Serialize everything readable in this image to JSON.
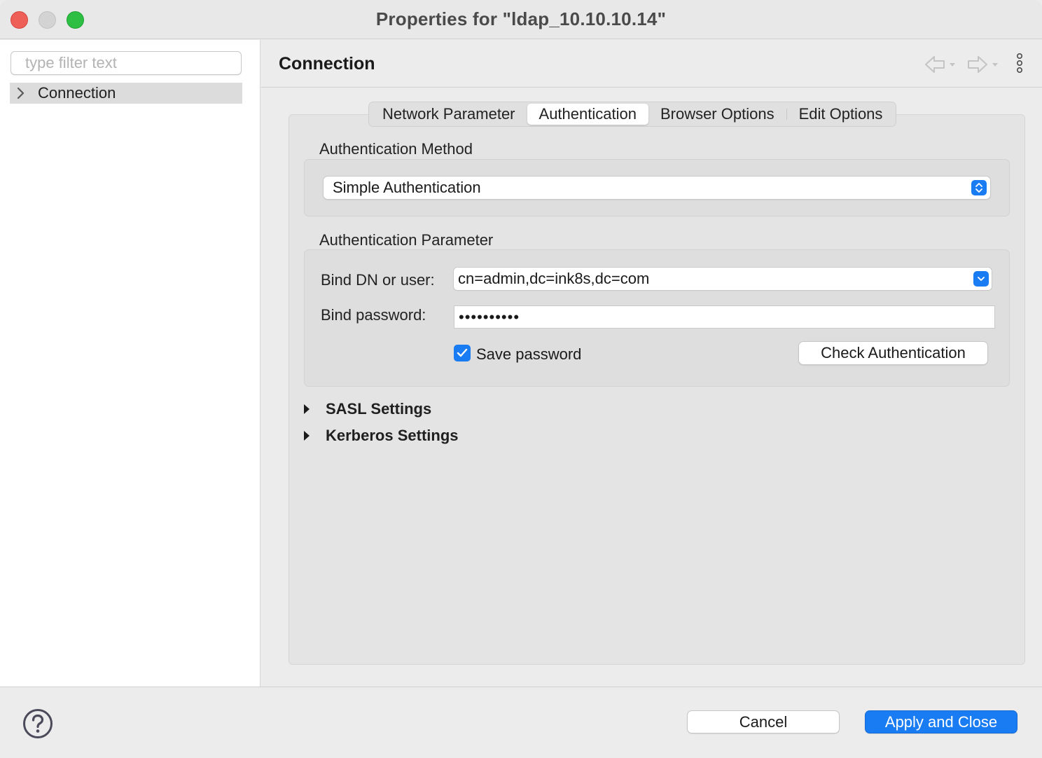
{
  "window": {
    "title": "Properties for \"ldap_10.10.10.14\""
  },
  "sidebar": {
    "filter_placeholder": "type filter text",
    "items": [
      {
        "label": "Connection",
        "expanded": false,
        "selected": true
      }
    ]
  },
  "page": {
    "title": "Connection",
    "tabs": [
      {
        "label": "Network Parameter",
        "active": false
      },
      {
        "label": "Authentication",
        "active": true
      },
      {
        "label": "Browser Options",
        "active": false
      },
      {
        "label": "Edit Options",
        "active": false
      }
    ],
    "auth_method": {
      "section_label": "Authentication Method",
      "selected": "Simple Authentication"
    },
    "auth_param": {
      "section_label": "Authentication Parameter",
      "bind_dn_label": "Bind DN or user:",
      "bind_dn_value": "cn=admin,dc=ink8s,dc=com",
      "bind_password_label": "Bind password:",
      "bind_password_masked": "••••••••••",
      "save_password_label": "Save password",
      "save_password_checked": true,
      "check_auth_label": "Check Authentication"
    },
    "expanders": [
      {
        "label": "SASL Settings"
      },
      {
        "label": "Kerberos Settings"
      }
    ]
  },
  "footer": {
    "cancel_label": "Cancel",
    "apply_label": "Apply and Close"
  },
  "icons": {
    "back": "back-arrow-icon",
    "forward": "forward-arrow-icon",
    "more": "vertical-ellipsis-icon",
    "help": "help-icon"
  },
  "colors": {
    "accent": "#1a7cf2",
    "close": "#ed5f57",
    "zoom": "#2dbe44"
  }
}
